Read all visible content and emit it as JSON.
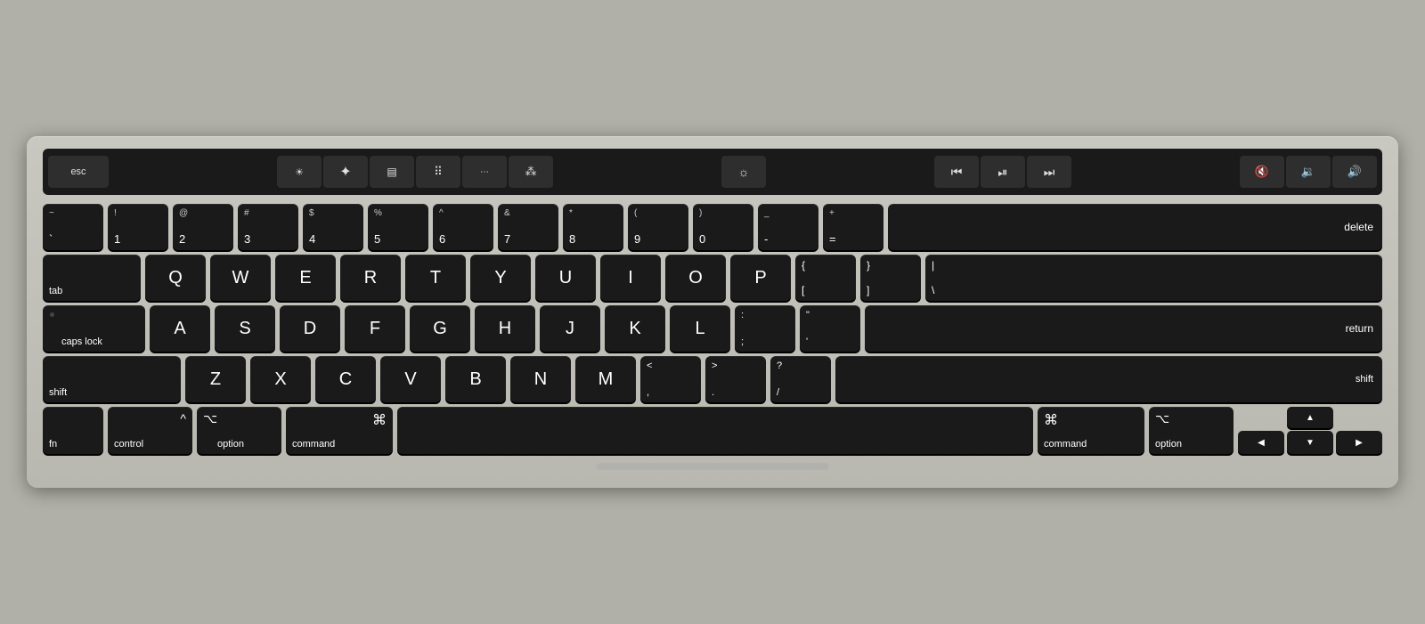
{
  "touchbar": {
    "keys": [
      {
        "id": "esc",
        "label": "esc",
        "type": "esc"
      },
      {
        "id": "brightness-down",
        "label": "☀",
        "type": "icon"
      },
      {
        "id": "brightness-up",
        "label": "☀",
        "type": "icon"
      },
      {
        "id": "mission-control",
        "label": "⊞",
        "type": "icon"
      },
      {
        "id": "launchpad",
        "label": "⠿",
        "type": "icon"
      },
      {
        "id": "keyboard-brightness-down",
        "label": "☀",
        "type": "icon"
      },
      {
        "id": "display-brightness",
        "label": "☀",
        "type": "icon"
      },
      {
        "id": "rewind",
        "label": "⏮",
        "type": "icon"
      },
      {
        "id": "play-pause",
        "label": "⏯",
        "type": "icon"
      },
      {
        "id": "fast-forward",
        "label": "⏭",
        "type": "icon"
      },
      {
        "id": "mute",
        "label": "🔇",
        "type": "icon"
      },
      {
        "id": "volume-down",
        "label": "🔉",
        "type": "icon"
      },
      {
        "id": "volume-up",
        "label": "🔊",
        "type": "icon"
      }
    ]
  },
  "rows": {
    "number_row": {
      "keys": [
        {
          "top": "~",
          "bottom": "`",
          "id": "backtick"
        },
        {
          "top": "!",
          "bottom": "1",
          "id": "1"
        },
        {
          "top": "@",
          "bottom": "2",
          "id": "2"
        },
        {
          "top": "#",
          "bottom": "3",
          "id": "3"
        },
        {
          "top": "$",
          "bottom": "4",
          "id": "4"
        },
        {
          "top": "%",
          "bottom": "5",
          "id": "5"
        },
        {
          "top": "^",
          "bottom": "6",
          "id": "6"
        },
        {
          "top": "&",
          "bottom": "7",
          "id": "7"
        },
        {
          "top": "*",
          "bottom": "8",
          "id": "8"
        },
        {
          "top": "(",
          "bottom": "9",
          "id": "9"
        },
        {
          "top": ")",
          "bottom": "0",
          "id": "0"
        },
        {
          "top": "_",
          "bottom": "-",
          "id": "minus"
        },
        {
          "top": "+",
          "bottom": "=",
          "id": "equals"
        }
      ],
      "delete": "delete"
    },
    "qwerty": [
      "Q",
      "W",
      "E",
      "R",
      "T",
      "Y",
      "U",
      "I",
      "O",
      "P"
    ],
    "asdf": [
      "A",
      "S",
      "D",
      "F",
      "G",
      "H",
      "J",
      "K",
      "L"
    ],
    "zxcv": [
      "Z",
      "X",
      "C",
      "V",
      "B",
      "N",
      "M"
    ],
    "brackets": {
      "left": [
        "{",
        "["
      ],
      "right": [
        "}",
        "]"
      ],
      "pipe": [
        "|",
        "\\"
      ]
    },
    "colon": [
      ":",
      ";"
    ],
    "quote": [
      "\"",
      "'"
    ],
    "less": [
      "<",
      ","
    ],
    "greater": [
      ">",
      "."
    ],
    "slash": [
      "?",
      "/"
    ]
  },
  "modifiers": {
    "tab": "tab",
    "caps_lock": "caps lock",
    "shift_l": "shift",
    "shift_r": "shift",
    "fn": "fn",
    "control": "control",
    "option_l": "option",
    "command_l": "command",
    "command_r": "command",
    "option_r": "option",
    "return": "return"
  },
  "arrows": {
    "up": "▲",
    "left": "◀",
    "down": "▼",
    "right": "▶"
  }
}
